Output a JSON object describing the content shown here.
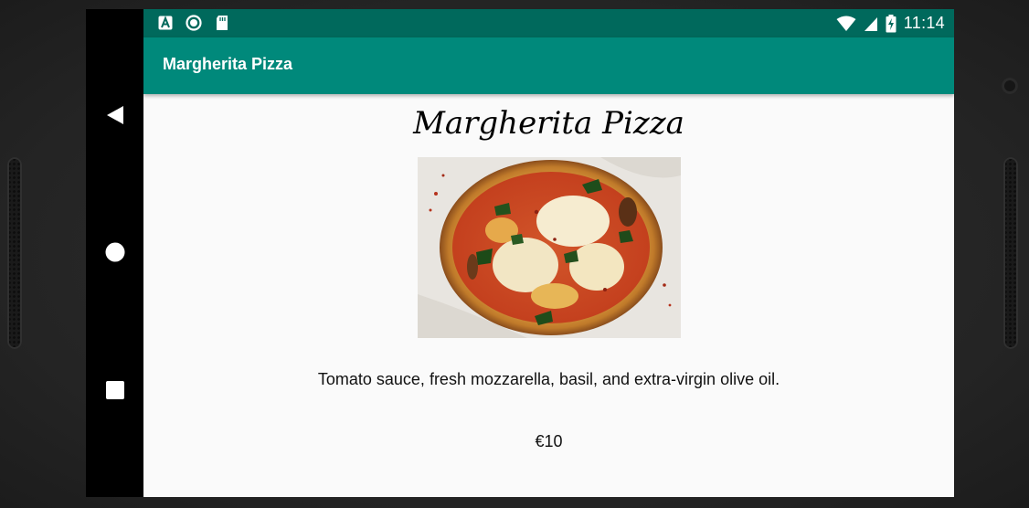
{
  "status_bar": {
    "time": "11:14",
    "notification_icons": [
      "a-badge-icon",
      "sync-circle-icon",
      "sd-card-icon"
    ],
    "status_icons": [
      "wifi-icon",
      "cell-signal-icon",
      "battery-charging-icon"
    ]
  },
  "app_bar": {
    "title": "Margherita Pizza"
  },
  "content": {
    "heading": "Margherita Pizza",
    "image_alt": "pizza-photo",
    "description": "Tomato sauce, fresh mozzarella, basil, and extra-virgin olive oil.",
    "price": "€10"
  },
  "navigation": {
    "buttons": [
      "back",
      "home",
      "recents"
    ]
  },
  "colors": {
    "status_bar": "#00695c",
    "app_bar": "#00897b",
    "background": "#fafafa",
    "nav_bar": "#000000"
  }
}
